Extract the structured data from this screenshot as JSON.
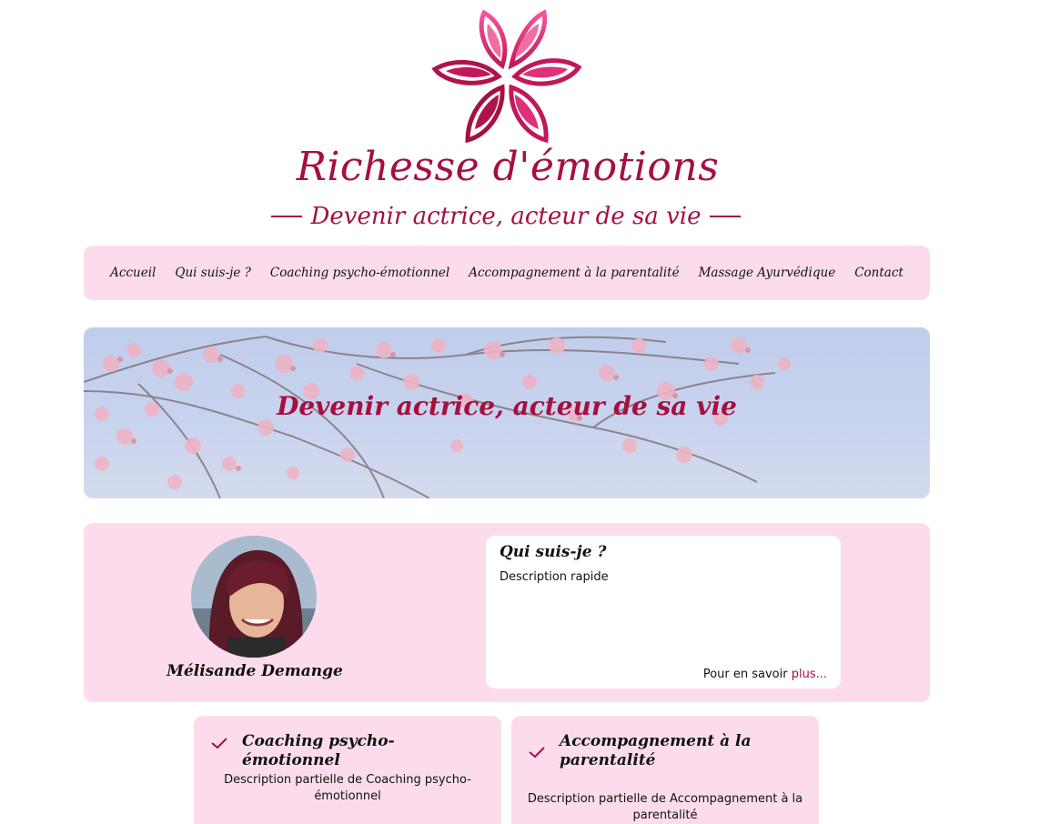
{
  "header": {
    "site_title": "Richesse d'émotions",
    "tagline": "Devenir actrice, acteur de sa vie"
  },
  "nav": {
    "items": [
      {
        "label": "Accueil"
      },
      {
        "label": "Qui suis-je ?"
      },
      {
        "label": "Coaching psycho-émotionnel"
      },
      {
        "label": "Accompagnement à la parentalité"
      },
      {
        "label": "Massage Ayurvédique"
      },
      {
        "label": "Contact"
      }
    ]
  },
  "hero": {
    "title": "Devenir actrice, acteur de sa vie"
  },
  "about": {
    "name": "Mélisande Demange",
    "card_title": "Qui suis-je ?",
    "description": "Description rapide",
    "more_prefix": "Pour en savoir ",
    "more_link": "plus..."
  },
  "services": [
    {
      "title": "Coaching psycho-émotionnel",
      "description": "Description partielle de Coaching psycho-émotionnel",
      "icon": "check-icon"
    },
    {
      "title": "Accompagnement à la parentalité",
      "description": "Description partielle de Accompagnement à la parentalité",
      "icon": "check-icon"
    }
  ],
  "colors": {
    "brand": "#a4103f",
    "pink_panel": "#fcdcec",
    "logo_light": "#f06fa0"
  }
}
